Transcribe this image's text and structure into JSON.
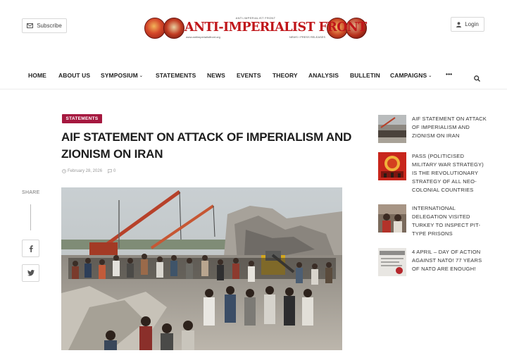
{
  "header": {
    "subscribe_label": "Subscribe",
    "login_label": "Login",
    "logo": {
      "top_text": "ANTI-IMPERIALIST FRONT",
      "title": "ANTI-IMPERIALIST FRONT",
      "bottom_left": "www.antiimperialistfront.org",
      "bottom_right": "NEWS / PRESS RELEASES"
    }
  },
  "nav": {
    "items": [
      {
        "label": "HOME"
      },
      {
        "label": "ABOUT US"
      },
      {
        "label": "SYMPOSIUM"
      },
      {
        "label": "STATEMENTS"
      },
      {
        "label": "NEWS"
      },
      {
        "label": "EVENTS"
      },
      {
        "label": "THEORY"
      },
      {
        "label": "ANALYSIS"
      },
      {
        "label": "BULLETIN"
      },
      {
        "label": "CAMPAIGNS"
      }
    ],
    "more_label": "•••"
  },
  "article": {
    "category": "STATEMENTS",
    "title": "AIF STATEMENT ON ATTACK OF IMPERIALISM AND ZIONISM ON IRAN",
    "date": "February 28, 2026",
    "comments": "0"
  },
  "share": {
    "label": "SHARE"
  },
  "sidebar": {
    "items": [
      {
        "title": "AIF STATEMENT ON ATTACK OF IMPERIALISM AND ZIONISM ON IRAN"
      },
      {
        "title": "PASS (POLITICISED MILITARY WAR STRATEGY) IS THE REVOLUTIONARY STRATEGY OF ALL NEO-COLONIAL COUNTRIES"
      },
      {
        "title": "INTERNATIONAL DELEGATION VISITED TURKEY TO INSPECT PIT-TYPE PRISONS"
      },
      {
        "title": "4 APRIL – DAY OF ACTION AGAINST NATO! 77 YEARS OF NATO ARE ENOUGH!"
      }
    ]
  },
  "colors": {
    "accent": "#a5183f",
    "logo_red": "#c0161a"
  }
}
